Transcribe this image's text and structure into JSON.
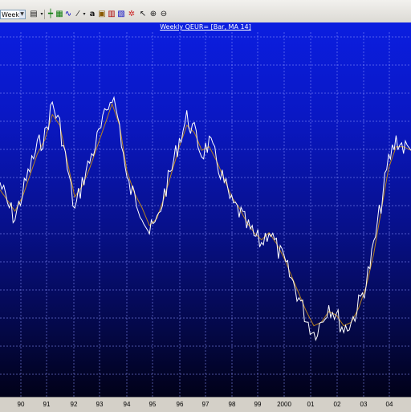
{
  "toolbar": {
    "period_value": "Weekly",
    "icons": [
      "chart-type-icon",
      "crosshair-icon",
      "grid-icon",
      "line-study-icon",
      "draw-line-icon",
      "text-tool-icon",
      "lock-icon",
      "candlestick-icon",
      "zoom-box-icon",
      "refresh-icon",
      "zoom-in-icon",
      "zoom-out-icon"
    ]
  },
  "chart": {
    "title": "Weekly QEUR= [Bar, MA 14]",
    "background_top": "#0b1ee0",
    "background_bottom": "#010118",
    "price_color": "#ffffff",
    "ma_color": "#b8821e"
  },
  "chart_data": {
    "type": "line",
    "title": "Weekly QEUR= [Bar, MA 14]",
    "x_tick_labels": [
      "90",
      "91",
      "92",
      "93",
      "94",
      "95",
      "96",
      "97",
      "98",
      "99",
      "2000",
      "01",
      "02",
      "03",
      "04"
    ],
    "series": [
      {
        "name": "Bar",
        "color": "#ffffff",
        "values": [
          0.58,
          0.52,
          0.48,
          0.55,
          0.62,
          0.68,
          0.71,
          0.8,
          0.74,
          0.62,
          0.5,
          0.58,
          0.64,
          0.7,
          0.76,
          0.83,
          0.74,
          0.58,
          0.54,
          0.5,
          0.44,
          0.47,
          0.55,
          0.62,
          0.7,
          0.76,
          0.72,
          0.66,
          0.69,
          0.64,
          0.58,
          0.52,
          0.5,
          0.46,
          0.43,
          0.41,
          0.45,
          0.4,
          0.36,
          0.31,
          0.26,
          0.2,
          0.16,
          0.19,
          0.24,
          0.21,
          0.17,
          0.19,
          0.24,
          0.3,
          0.4,
          0.52,
          0.64,
          0.7,
          0.68,
          0.67
        ]
      },
      {
        "name": "MA 14",
        "color": "#b8821e",
        "values": [
          0.56,
          0.53,
          0.5,
          0.54,
          0.6,
          0.66,
          0.7,
          0.77,
          0.74,
          0.64,
          0.54,
          0.57,
          0.62,
          0.68,
          0.74,
          0.8,
          0.74,
          0.61,
          0.55,
          0.51,
          0.46,
          0.48,
          0.54,
          0.61,
          0.68,
          0.74,
          0.72,
          0.67,
          0.68,
          0.64,
          0.59,
          0.54,
          0.51,
          0.47,
          0.44,
          0.42,
          0.44,
          0.41,
          0.37,
          0.32,
          0.27,
          0.22,
          0.18,
          0.19,
          0.22,
          0.21,
          0.18,
          0.19,
          0.23,
          0.29,
          0.38,
          0.5,
          0.62,
          0.68,
          0.68,
          0.67
        ]
      }
    ],
    "grid": true
  }
}
